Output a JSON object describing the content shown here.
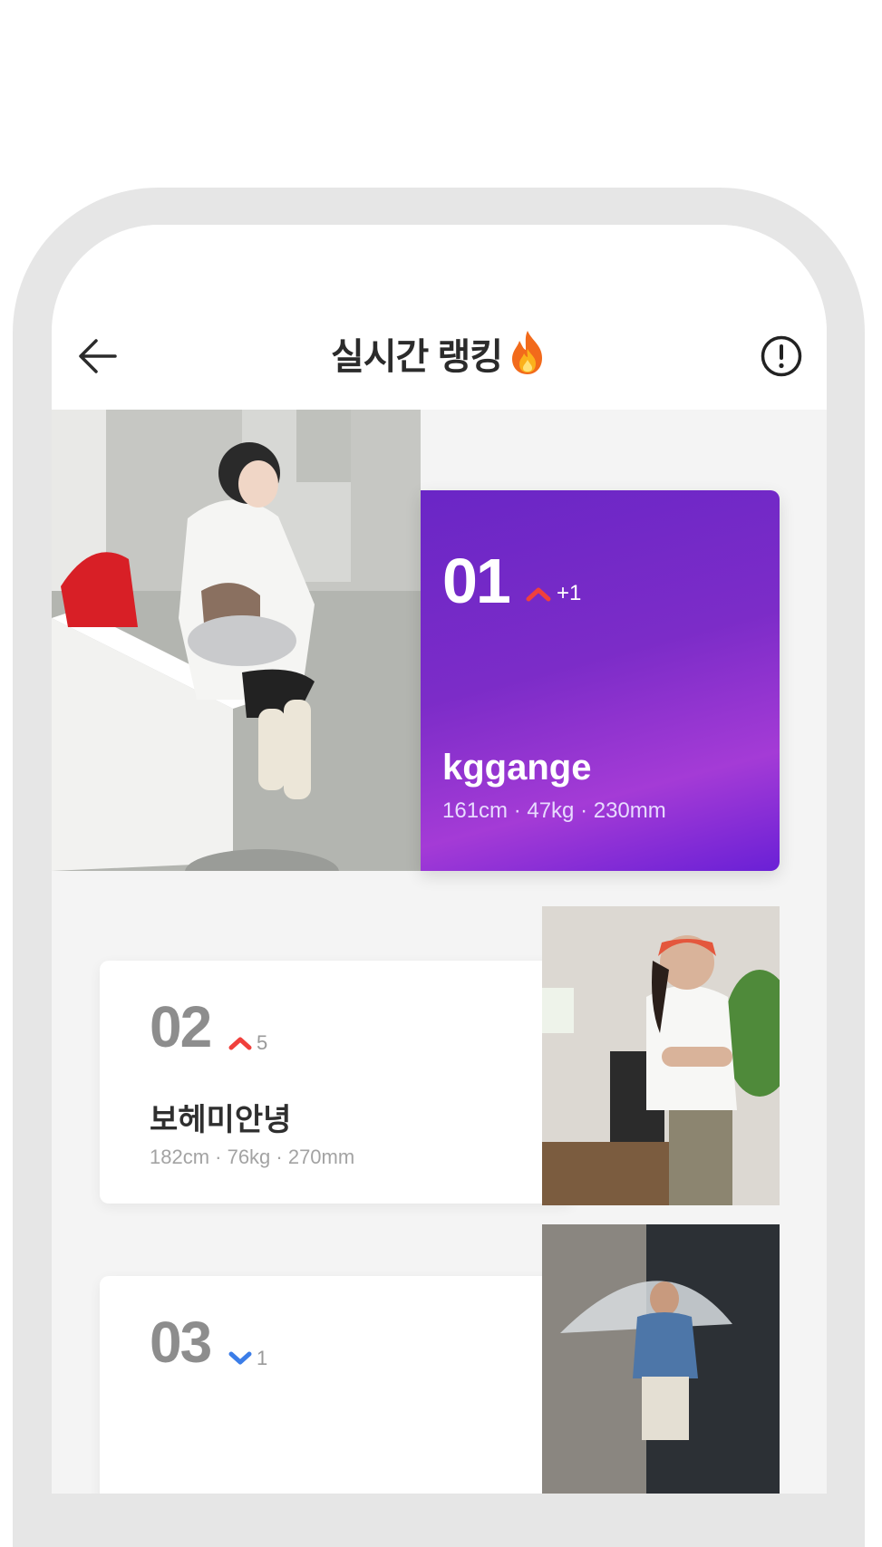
{
  "header": {
    "title": "실시간 랭킹"
  },
  "rankings": [
    {
      "rank": "01",
      "trend": "up",
      "delta": "+1",
      "name": "kggange",
      "spec": "161cm · 47kg · 230mm"
    },
    {
      "rank": "02",
      "trend": "up",
      "delta": "5",
      "name": "보헤미안녕",
      "spec": "182cm · 76kg · 270mm"
    },
    {
      "rank": "03",
      "trend": "down",
      "delta": "1",
      "name": "",
      "spec": ""
    }
  ],
  "colors": {
    "accent_purple": "#7a2cc8",
    "trend_up": "#f0403c",
    "trend_down": "#3b7de8",
    "background": "#f4f4f4"
  },
  "icons": {
    "back": "arrow-left-icon",
    "info": "exclamation-circle-icon",
    "title_decoration": "fire-icon"
  }
}
